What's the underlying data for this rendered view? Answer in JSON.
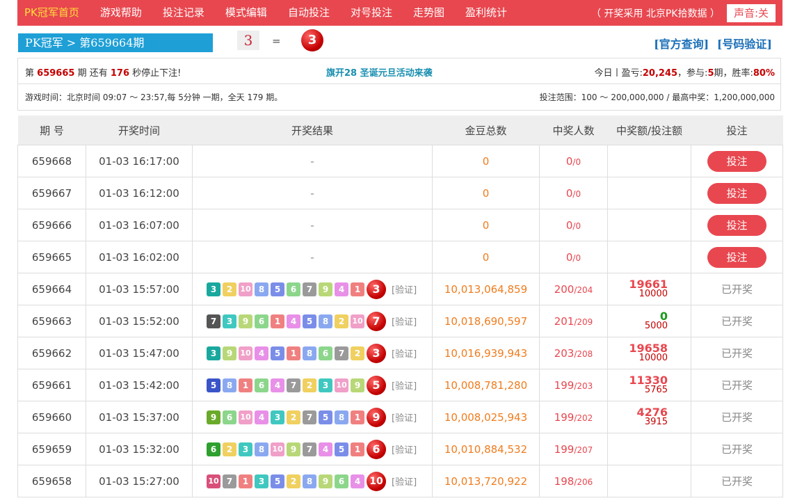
{
  "nav": {
    "items": [
      "PK冠军首页",
      "游戏帮助",
      "投注记录",
      "模式编辑",
      "自动投注",
      "对号投注",
      "走势图",
      "盈利统计"
    ],
    "note": "（ 开奖采用 北京PK拾数据 ）",
    "sound": "声音:关"
  },
  "period": {
    "title": "PK冠军 > 第659664期",
    "result_box": "3",
    "eq": "=",
    "result_ball": "3",
    "links": [
      "[官方查询]",
      "[号码验证]"
    ]
  },
  "info1": {
    "p1": "第",
    "period": "659665",
    "p2": "期 还有",
    "seconds": "176",
    "p3": "秒停止下注!",
    "banner": "旗开28 圣诞元旦活动来袭",
    "today_prefix": "今日丨盈亏:",
    "profit": "20,245",
    "join_prefix": "，参与:",
    "join": "5",
    "join_suffix": "期，胜率:",
    "rate": "80%"
  },
  "info2": {
    "time": "游戏时间：北京时间 09:07 ～ 23:57,每 5分钟 一期，全天 179 期。",
    "range": "投注范围：100 ～ 200,000,000 / 最高中奖：1,200,000,000"
  },
  "table": {
    "headers": [
      "期 号",
      "开奖时间",
      "开奖结果",
      "金豆总数",
      "中奖人数",
      "中奖额/投注额",
      "投注"
    ],
    "bet_label": "投注",
    "opened_label": "已开奖",
    "verify_label": "[验证]",
    "rows": [
      {
        "period": "659668",
        "time": "01-03 16:17:00",
        "result": "-",
        "beans": "0",
        "win": "0",
        "total": "0",
        "bet": true
      },
      {
        "period": "659667",
        "time": "01-03 16:12:00",
        "result": "-",
        "beans": "0",
        "win": "0",
        "total": "0",
        "bet": true
      },
      {
        "period": "659666",
        "time": "01-03 16:07:00",
        "result": "-",
        "beans": "0",
        "win": "0",
        "total": "0",
        "bet": true
      },
      {
        "period": "659665",
        "time": "01-03 16:02:00",
        "result": "-",
        "beans": "0",
        "win": "0",
        "total": "0",
        "bet": true
      },
      {
        "period": "659664",
        "time": "01-03 15:57:00",
        "nums": [
          3,
          2,
          10,
          8,
          5,
          6,
          7,
          9,
          4,
          1
        ],
        "ball": "3",
        "beans": "10,013,064,859",
        "win": "200",
        "total": "204",
        "amt": "19661",
        "stake": "10000",
        "bet": false
      },
      {
        "period": "659663",
        "time": "01-03 15:52:00",
        "nums": [
          7,
          3,
          9,
          6,
          1,
          4,
          5,
          8,
          2,
          10
        ],
        "ball": "7",
        "beans": "10,018,690,597",
        "win": "201",
        "total": "209",
        "amt": "0",
        "stake": "5000",
        "bet": false
      },
      {
        "period": "659662",
        "time": "01-03 15:47:00",
        "nums": [
          3,
          9,
          10,
          4,
          5,
          1,
          8,
          6,
          7,
          2
        ],
        "ball": "3",
        "beans": "10,016,939,943",
        "win": "203",
        "total": "208",
        "amt": "19658",
        "stake": "10000",
        "bet": false
      },
      {
        "period": "659661",
        "time": "01-03 15:42:00",
        "nums": [
          5,
          8,
          1,
          6,
          4,
          7,
          2,
          3,
          10,
          9
        ],
        "ball": "5",
        "beans": "10,008,781,280",
        "win": "199",
        "total": "203",
        "amt": "11330",
        "stake": "5765",
        "bet": false
      },
      {
        "period": "659660",
        "time": "01-03 15:37:00",
        "nums": [
          9,
          6,
          10,
          4,
          3,
          2,
          7,
          5,
          8,
          1
        ],
        "ball": "9",
        "beans": "10,008,025,943",
        "win": "199",
        "total": "202",
        "amt": "4276",
        "stake": "3915",
        "bet": false
      },
      {
        "period": "659659",
        "time": "01-03 15:32:00",
        "nums": [
          6,
          2,
          3,
          8,
          10,
          9,
          7,
          4,
          5,
          1
        ],
        "ball": "6",
        "beans": "10,010,884,532",
        "win": "199",
        "total": "207",
        "amt": "",
        "stake": "",
        "bet": false
      },
      {
        "period": "659658",
        "time": "01-03 15:27:00",
        "nums": [
          10,
          7,
          1,
          3,
          5,
          2,
          8,
          9,
          6,
          4
        ],
        "ball": "10",
        "beans": "10,013,720,922",
        "win": "198",
        "total": "206",
        "amt": "",
        "stake": "",
        "bet": false
      }
    ]
  },
  "number_colors": {
    "1": "#f08080",
    "2": "#f0d060",
    "3": "#40c8c0",
    "4": "#e890e8",
    "5": "#7a8ee8",
    "6": "#8cd68c",
    "7": "#9a9a9a",
    "8": "#8aa8f0",
    "9": "#b8d878",
    "10": "#f0a0c8"
  },
  "number_colors_dark": {
    "3": "#1aa89e",
    "5": "#3a55c8",
    "6": "#2ea02e",
    "7": "#555555",
    "9": "#6aaa2a",
    "10": "#d8507a"
  }
}
